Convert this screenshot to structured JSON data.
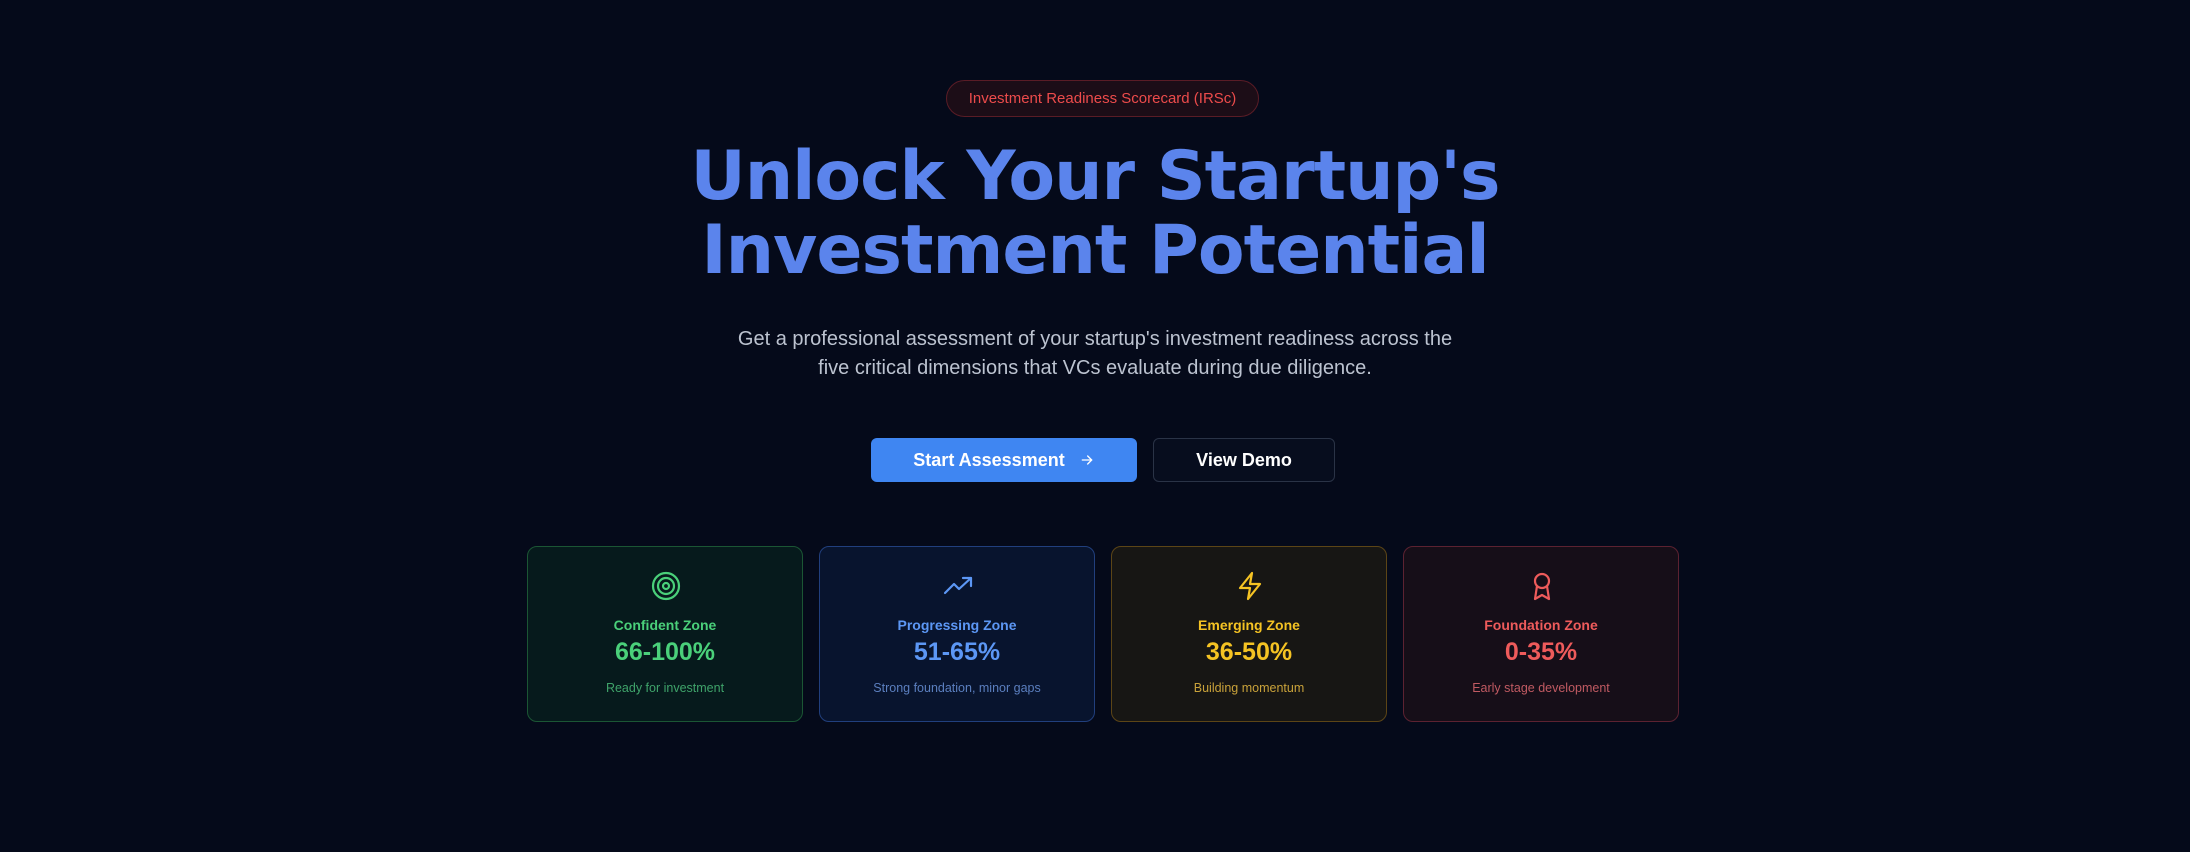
{
  "badge": {
    "label": "Investment Readiness Scorecard (IRSc)",
    "color": "#ec4b4b"
  },
  "hero": {
    "title_line1": "Unlock Your Startup's",
    "title_line2": "Investment Potential",
    "subtitle_line1": "Get a professional assessment of your startup's investment readiness across the",
    "subtitle_line2": "five critical dimensions that VCs evaluate during due diligence."
  },
  "actions": {
    "primary_label": "Start Assessment",
    "primary_icon": "arrow-right-icon",
    "secondary_label": "View Demo",
    "accent": "#3f86f2"
  },
  "zones": [
    {
      "title": "Confident Zone",
      "range": "66-100%",
      "description": "Ready for investment",
      "icon": "target-icon",
      "color": "#4ad07a"
    },
    {
      "title": "Progressing Zone",
      "range": "51-65%",
      "description": "Strong foundation, minor gaps",
      "icon": "trending-up-icon",
      "color": "#5c97f5"
    },
    {
      "title": "Emerging Zone",
      "range": "36-50%",
      "description": "Building momentum",
      "icon": "lightning-icon",
      "color": "#f5c323"
    },
    {
      "title": "Foundation Zone",
      "range": "0-35%",
      "description": "Early stage development",
      "icon": "award-icon",
      "color": "#ee5b5b"
    }
  ]
}
